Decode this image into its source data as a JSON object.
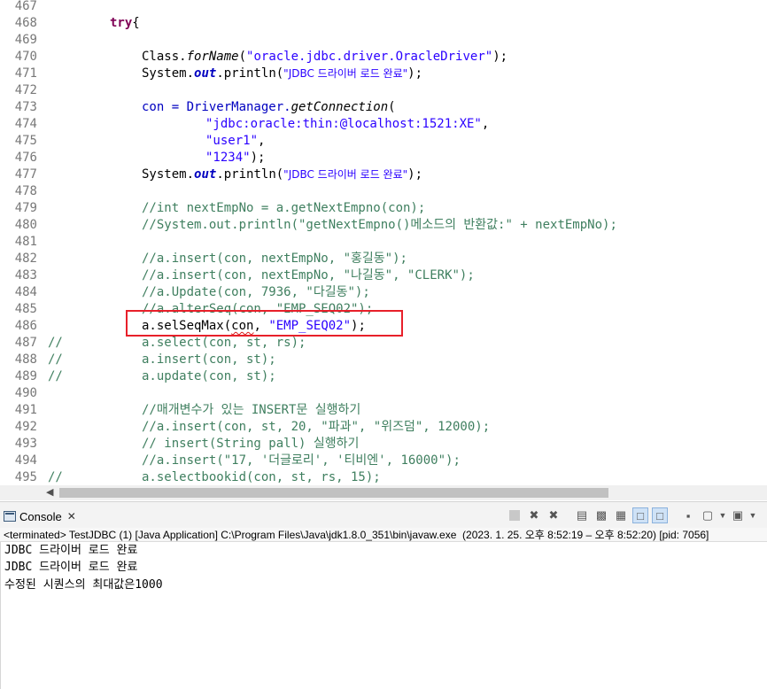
{
  "editor": {
    "lines": [
      {
        "n": "467"
      },
      {
        "n": "468"
      },
      {
        "n": "469"
      },
      {
        "n": "470"
      },
      {
        "n": "471"
      },
      {
        "n": "472"
      },
      {
        "n": "473"
      },
      {
        "n": "474"
      },
      {
        "n": "475"
      },
      {
        "n": "476"
      },
      {
        "n": "477"
      },
      {
        "n": "478"
      },
      {
        "n": "479"
      },
      {
        "n": "480"
      },
      {
        "n": "481"
      },
      {
        "n": "482"
      },
      {
        "n": "483"
      },
      {
        "n": "484"
      },
      {
        "n": "485"
      },
      {
        "n": "486"
      },
      {
        "n": "487"
      },
      {
        "n": "488"
      },
      {
        "n": "489"
      },
      {
        "n": "490"
      },
      {
        "n": "491"
      },
      {
        "n": "492"
      },
      {
        "n": "493"
      },
      {
        "n": "494"
      },
      {
        "n": "495"
      }
    ],
    "t": {
      "try": "try",
      "brace": "{",
      "class_forname_a": "Class.",
      "forname": "forName",
      "paren_open": "(",
      "driver": "\"oracle.jdbc.driver.OracleDriver\"",
      "close_semi": ");",
      "system": "System.",
      "out": "out",
      "println": ".println(",
      "jdbc_done": "\"JDBC 드라이버 로드 완료\"",
      "con_eq": "con = DriverManager.",
      "getconn": "getConnection",
      "url": "\"jdbc:oracle:thin:@localhost:1521:XE\"",
      "comma": ",",
      "user": "\"user1\"",
      "pw": "\"1234\"",
      "c479": "//int nextEmpNo = a.getNextEmpno(con);",
      "c480": "//System.out.println(\"getNextEmpno()메소드의 반환값:\" + nextEmpNo);",
      "c482": "//a.insert(con, nextEmpNo, \"홍길동\");",
      "c483": "//a.insert(con, nextEmpNo, \"나길동\", \"CLERK\");",
      "c484": "//a.Update(con, 7936, \"다길동\");",
      "c485": "//a.alterSeq(con, \"EMP_SEQ02\");",
      "l486a": "a.selSeqMax(",
      "con": "con",
      "l486b": ", ",
      "seq": "\"EMP_SEQ02\"",
      "slashes": "//",
      "l487": "a.select(con, st, rs);",
      "l488": "a.insert(con, st);",
      "l489": "a.update(con, st);",
      "c491": "//매개변수가 있는 INSERT문 실행하기",
      "c492": "//a.insert(con, st, 20, \"파과\", \"위즈덤\", 12000);",
      "c493": "// insert(String pall) 실행하기",
      "c494": "//a.insert(\"17, '더글로리', '티비엔', 16000\");",
      "l495": "a.selectbookid(con, st, rs, 15);"
    }
  },
  "console": {
    "tab_label": "Console",
    "tab_close": "✕",
    "status": "<terminated> TestJDBC (1) [Java Application] C:\\Program Files\\Java\\jdk1.8.0_351\\bin\\javaw.exe  (2023. 1. 25. 오후 8:52:19 – 오후 8:52:20) [pid: 7056]",
    "output": [
      "JDBC 드라이버 로드 완료",
      "JDBC 드라이버 로드 완료",
      "수정된 시퀀스의 최대값은1000"
    ]
  },
  "colors": {
    "keyword": "#7f0055",
    "string": "#2a00ff",
    "comment": "#3f7f5f",
    "static_field": "#0000c0",
    "highlight_box": "#e8202a"
  },
  "icons": [
    "console-icon",
    "terminate-icon",
    "remove-launch-icon",
    "remove-all-icon",
    "clear-console-icon",
    "scroll-lock-icon",
    "word-wrap-icon",
    "pin-console-icon",
    "show-console-stdout-icon",
    "show-console-stderr-icon",
    "open-console-icon",
    "display-console-icon"
  ]
}
